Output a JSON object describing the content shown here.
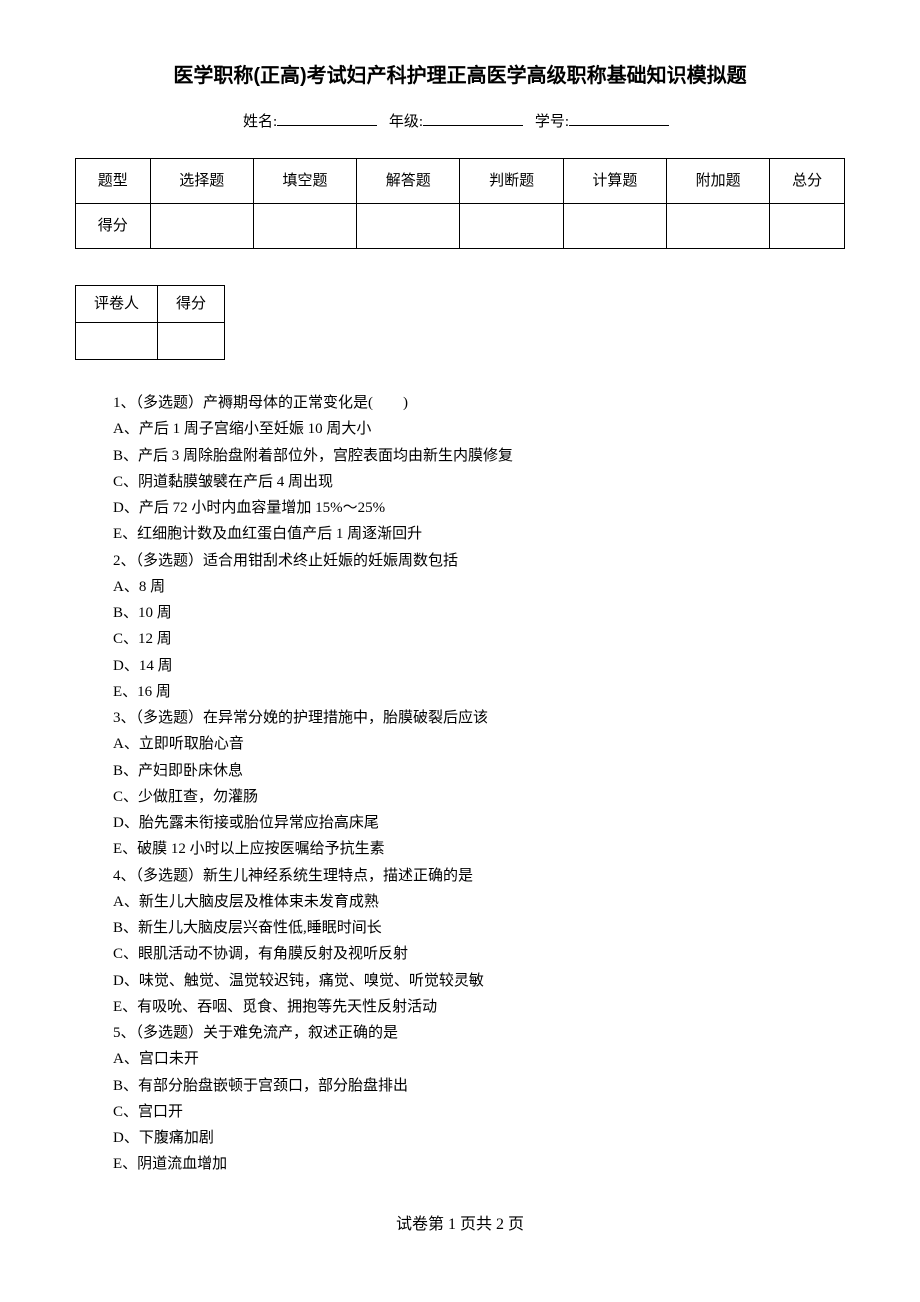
{
  "title": "医学职称(正高)考试妇产科护理正高医学高级职称基础知识模拟题",
  "info": {
    "name_label": "姓名:",
    "grade_label": "年级:",
    "id_label": "学号:"
  },
  "score_table": {
    "headers": [
      "题型",
      "选择题",
      "填空题",
      "解答题",
      "判断题",
      "计算题",
      "附加题",
      "总分"
    ],
    "score_row_label": "得分"
  },
  "grader_table": {
    "grader": "评卷人",
    "score": "得分"
  },
  "questions": [
    "1、（多选题）产褥期母体的正常变化是(　　)",
    "A、产后 1 周子宫缩小至妊娠 10 周大小",
    "B、产后 3 周除胎盘附着部位外，宫腔表面均由新生内膜修复",
    "C、阴道黏膜皱襞在产后 4 周出现",
    "D、产后 72 小时内血容量增加 15%～25%",
    "E、红细胞计数及血红蛋白值产后 1 周逐渐回升",
    "2、（多选题）适合用钳刮术终止妊娠的妊娠周数包括",
    "A、8 周",
    "B、10 周",
    "C、12 周",
    "D、14 周",
    "E、16 周",
    "3、（多选题）在异常分娩的护理措施中，胎膜破裂后应该",
    "A、立即听取胎心音",
    "B、产妇即卧床休息",
    "C、少做肛查，勿灌肠",
    "D、胎先露未衔接或胎位异常应抬高床尾",
    "E、破膜 12 小时以上应按医嘱给予抗生素",
    "4、（多选题）新生儿神经系统生理特点，描述正确的是",
    "A、新生儿大脑皮层及椎体束未发育成熟",
    "B、新生儿大脑皮层兴奋性低,睡眠时间长",
    "C、眼肌活动不协调，有角膜反射及视听反射",
    "D、味觉、触觉、温觉较迟钝，痛觉、嗅觉、听觉较灵敏",
    "E、有吸吮、吞咽、觅食、拥抱等先天性反射活动",
    "5、（多选题）关于难免流产，叙述正确的是",
    "A、宫口未开",
    "B、有部分胎盘嵌顿于宫颈口，部分胎盘排出",
    "C、宫口开",
    "D、下腹痛加剧",
    "E、阴道流血增加"
  ],
  "footer": "试卷第 1 页共 2 页"
}
